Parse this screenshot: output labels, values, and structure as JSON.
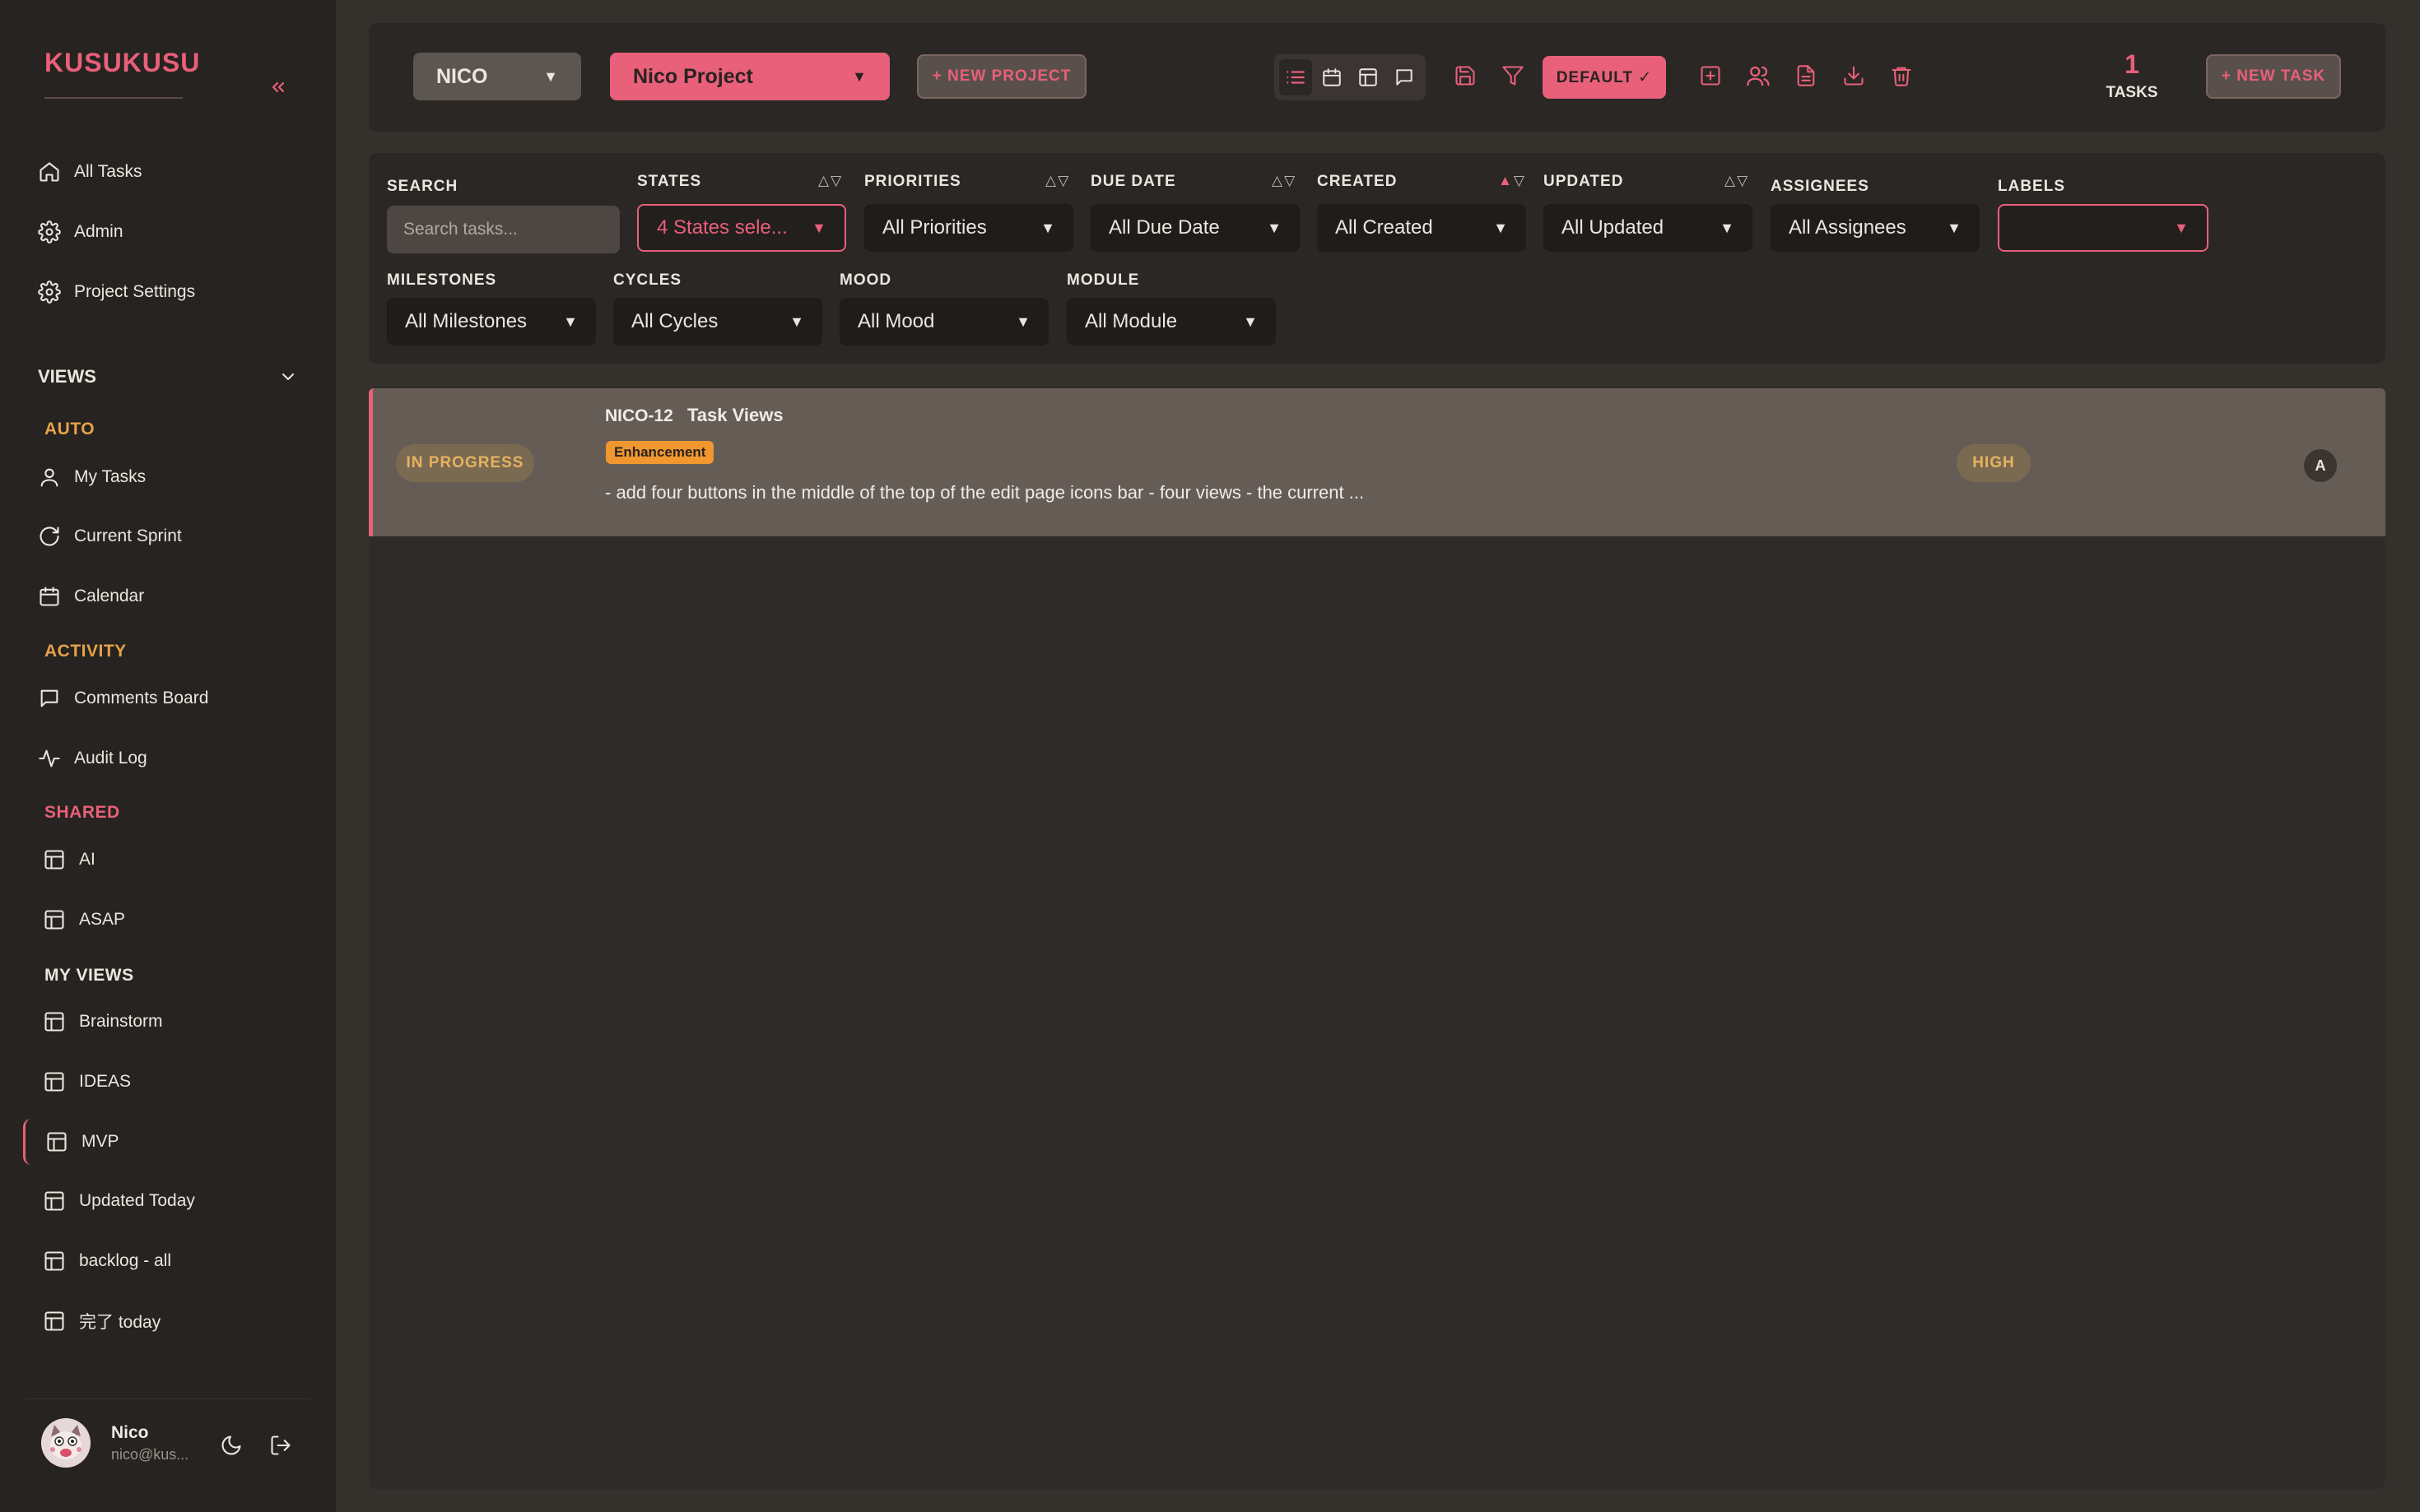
{
  "sidebar": {
    "brand": "KUSUKUSU",
    "top_items": [
      {
        "label": "All Tasks",
        "icon": "home-icon"
      },
      {
        "label": "Admin",
        "icon": "gear-icon"
      },
      {
        "label": "Project Settings",
        "icon": "gear-icon"
      }
    ],
    "views_label": "VIEWS",
    "sections": {
      "auto": "AUTO",
      "activity": "ACTIVITY",
      "shared": "SHARED",
      "my_views": "MY VIEWS"
    },
    "auto_items": [
      {
        "label": "My Tasks",
        "icon": "user-icon"
      },
      {
        "label": "Current Sprint",
        "icon": "refresh-icon"
      },
      {
        "label": "Calendar",
        "icon": "calendar-icon"
      }
    ],
    "activity_items": [
      {
        "label": "Comments Board",
        "icon": "comment-icon"
      },
      {
        "label": "Audit Log",
        "icon": "activity-icon"
      }
    ],
    "shared_items": [
      {
        "label": "AI"
      },
      {
        "label": "ASAP"
      }
    ],
    "my_view_items": [
      {
        "label": "Brainstorm"
      },
      {
        "label": "IDEAS"
      },
      {
        "label": "MVP",
        "active": true
      },
      {
        "label": "Updated Today"
      },
      {
        "label": "backlog - all"
      },
      {
        "label": "完了 today"
      }
    ],
    "user": {
      "name": "Nico",
      "email": "nico@kus..."
    }
  },
  "topbar": {
    "workspace": "NICO",
    "project": "Nico Project",
    "new_project": "+ NEW PROJECT",
    "default_label": "DEFAULT ✓",
    "task_count": "1",
    "task_count_label": "TASKS",
    "new_task": "+ NEW TASK"
  },
  "filters": {
    "search": {
      "label": "SEARCH",
      "placeholder": "Search tasks..."
    },
    "states": {
      "label": "STATES",
      "value": "4 States sele..."
    },
    "priorities": {
      "label": "PRIORITIES",
      "value": "All Priorities"
    },
    "due_date": {
      "label": "DUE DATE",
      "value": "All Due Date"
    },
    "created": {
      "label": "CREATED",
      "value": "All Created"
    },
    "updated": {
      "label": "UPDATED",
      "value": "All Updated"
    },
    "assignees": {
      "label": "ASSIGNEES",
      "value": "All Assignees"
    },
    "labels": {
      "label": "LABELS",
      "value": ""
    },
    "milestones": {
      "label": "MILESTONES",
      "value": "All Milestones"
    },
    "cycles": {
      "label": "CYCLES",
      "value": "All Cycles"
    },
    "mood": {
      "label": "MOOD",
      "value": "All Mood"
    },
    "module": {
      "label": "MODULE",
      "value": "All Module"
    },
    "sort_glyph": "△▽",
    "sort_up": "▲",
    "sort_down": "▽",
    "dropdown_glyph": "▼"
  },
  "tasks": [
    {
      "state": "IN PROGRESS",
      "id": "NICO-12",
      "title": "Task Views",
      "label": "Enhancement",
      "description": "- add four buttons in the middle of the top of the edit page icons bar - four views - the current ...",
      "priority": "HIGH",
      "assignee": "A"
    }
  ],
  "colors": {
    "accent": "#e8607a",
    "sidebar_bg": "#262320",
    "page_bg": "#34302c",
    "section_orange": "#e7a24a",
    "section_pink": "#e8607a"
  }
}
